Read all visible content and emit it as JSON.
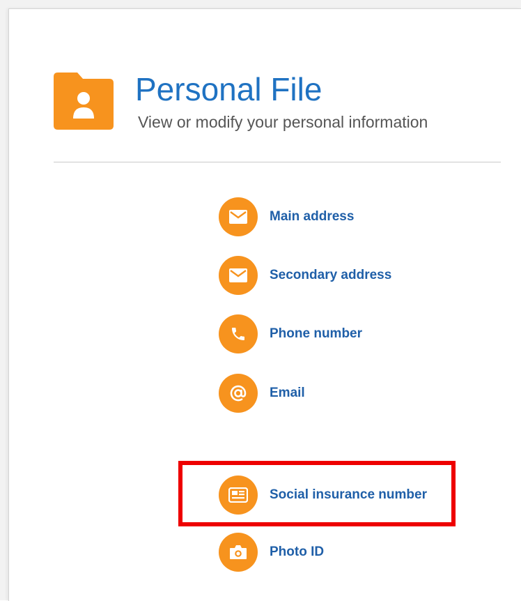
{
  "header": {
    "title": "Personal File",
    "subtitle": "View or modify your personal information",
    "icon": "folder-person-icon"
  },
  "colors": {
    "accent_orange": "#f7931e",
    "title_blue": "#1f72c2",
    "link_blue": "#1f5fa8",
    "highlight_red": "#ee0000"
  },
  "menu": {
    "items": [
      {
        "label": "Main address",
        "icon": "envelope-icon"
      },
      {
        "label": "Secondary address",
        "icon": "envelope-icon"
      },
      {
        "label": "Phone number",
        "icon": "phone-icon"
      },
      {
        "label": "Email",
        "icon": "at-sign-icon"
      },
      {
        "label": "Social insurance number",
        "icon": "id-card-icon",
        "highlighted": true
      },
      {
        "label": "Photo ID",
        "icon": "camera-icon"
      }
    ]
  }
}
